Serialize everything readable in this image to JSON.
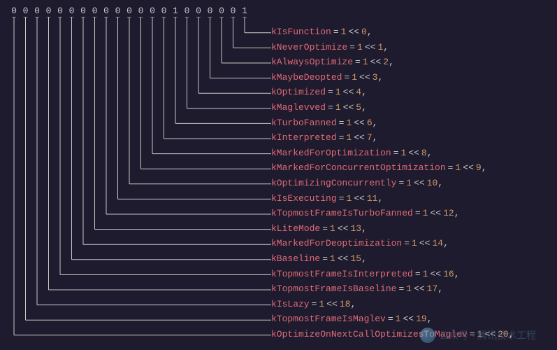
{
  "bits": [
    "0",
    "0",
    "0",
    "0",
    "0",
    "0",
    "0",
    "0",
    "0",
    "0",
    "0",
    "0",
    "0",
    "0",
    "1",
    "0",
    "0",
    "0",
    "0",
    "0",
    "1"
  ],
  "flags": [
    {
      "name": "kIsFunction",
      "shift": "0"
    },
    {
      "name": "kNeverOptimize",
      "shift": "1"
    },
    {
      "name": "kAlwaysOptimize",
      "shift": "2"
    },
    {
      "name": "kMaybeDeopted",
      "shift": "3"
    },
    {
      "name": "kOptimized",
      "shift": "4"
    },
    {
      "name": "kMaglevved",
      "shift": "5"
    },
    {
      "name": "kTurboFanned",
      "shift": "6"
    },
    {
      "name": "kInterpreted",
      "shift": "7"
    },
    {
      "name": "kMarkedForOptimization",
      "shift": "8"
    },
    {
      "name": "kMarkedForConcurrentOptimization",
      "shift": "9"
    },
    {
      "name": "kOptimizingConcurrently",
      "shift": "10"
    },
    {
      "name": "kIsExecuting",
      "shift": "11"
    },
    {
      "name": "kTopmostFrameIsTurboFanned",
      "shift": "12"
    },
    {
      "name": "kLiteMode",
      "shift": "13"
    },
    {
      "name": "kMarkedForDeoptimization",
      "shift": "14"
    },
    {
      "name": "kBaseline",
      "shift": "15"
    },
    {
      "name": "kTopmostFrameIsInterpreted",
      "shift": "16"
    },
    {
      "name": "kTopmostFrameIsBaseline",
      "shift": "17"
    },
    {
      "name": "kIsLazy",
      "shift": "18"
    },
    {
      "name": "kTopmostFrameIsMaglev",
      "shift": "19"
    },
    {
      "name": "kOptimizeOnNextCallOptimizesToMaglev",
      "shift": "20"
    }
  ],
  "syntax": {
    "eq": "=",
    "one": "1",
    "shift": "<<",
    "comma": ","
  },
  "watermark": "公众号 · 腾讯技术工程",
  "colors": {
    "bg": "#1e1b2e",
    "flagName": "#e06b75",
    "number": "#d19a66",
    "line": "#c8c8c8"
  }
}
